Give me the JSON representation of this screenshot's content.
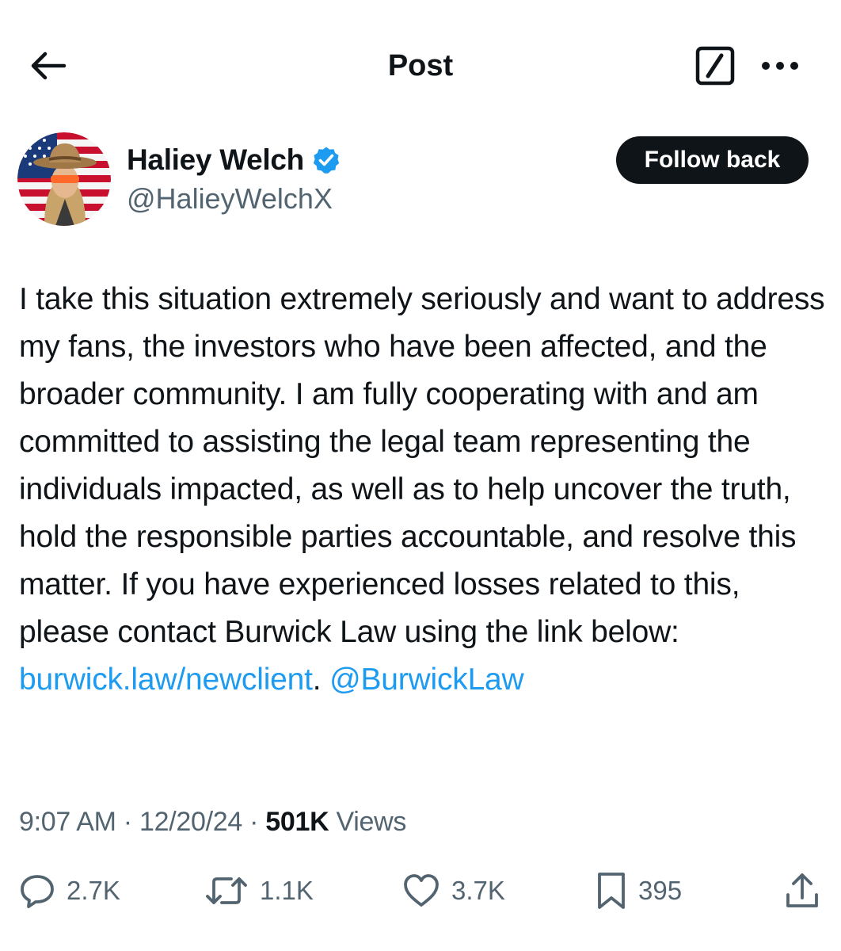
{
  "header": {
    "title": "Post"
  },
  "author": {
    "display_name": "Haliey Welch",
    "handle": "@HalieyWelchX",
    "verified": true,
    "follow_label": "Follow back"
  },
  "post": {
    "text_main": "I take this situation extremely seriously and want to address my fans, the investors who have been affected, and the broader community. I am fully cooperating with and am committed to assisting the legal team representing the individuals impacted, as well as to help uncover the truth, hold the responsible parties accountable, and resolve this matter. If you have experienced losses related to this, please contact Burwick Law using the link below: ",
    "link_url": "burwick.law/newclient",
    "after_link": ". ",
    "mention": "@BurwickLaw"
  },
  "meta": {
    "time": "9:07 AM",
    "sep1": " · ",
    "date": "12/20/24",
    "sep2": " · ",
    "views_count": "501K",
    "views_label": " Views"
  },
  "actions": {
    "replies": "2.7K",
    "reposts": "1.1K",
    "likes": "3.7K",
    "bookmarks": "395"
  },
  "icons": {
    "back": "arrow-left-icon",
    "compose": "compose-icon",
    "more": "more-horizontal-icon",
    "verified": "verified-badge-icon",
    "reply": "reply-icon",
    "repost": "repost-icon",
    "like": "heart-icon",
    "bookmark": "bookmark-icon",
    "share": "share-icon"
  },
  "colors": {
    "accent": "#1d9bf0",
    "text": "#0f1419",
    "secondary": "#536471",
    "button_bg": "#0f1419"
  }
}
